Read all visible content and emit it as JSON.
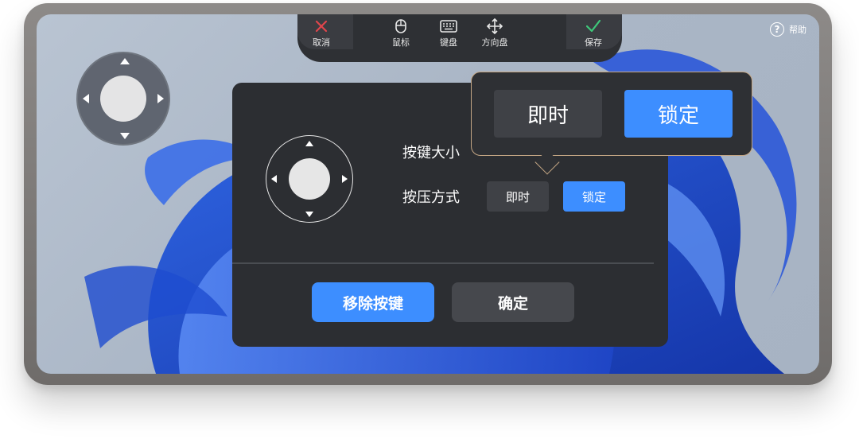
{
  "toolbar": {
    "cancel_label": "取消",
    "mouse_label": "鼠标",
    "keyboard_label": "键盘",
    "dpad_label": "方向盘",
    "save_label": "保存"
  },
  "help": {
    "label": "帮助",
    "icon_glyph": "?"
  },
  "dialog": {
    "key_size_label": "按键大小",
    "press_mode_label": "按压方式",
    "press_modes": [
      "即时",
      "锁定"
    ],
    "selected_press_mode": "锁定",
    "remove_key_label": "移除按键",
    "confirm_label": "确定"
  },
  "popover": {
    "options": [
      "即时",
      "锁定"
    ],
    "selected": "锁定"
  },
  "colors": {
    "accent": "#3d8eff",
    "cancel_red": "#e0454c",
    "save_green": "#3ec97a",
    "dialog_bg": "#2c2e32",
    "popover_border": "#c4a684"
  }
}
